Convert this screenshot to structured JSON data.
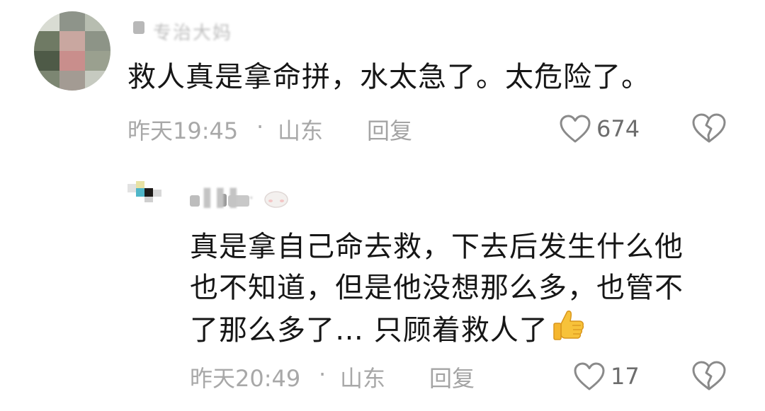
{
  "comments": [
    {
      "text": "救人真是拿命拼，水太急了。太危险了。",
      "time": "昨天19:45",
      "separator": "·",
      "location": "山东",
      "reply_label": "回复",
      "likes": "674",
      "username_obscured": "专治大妈",
      "icons": {
        "like": "heart-outline-icon",
        "dislike": "broken-heart-icon"
      }
    },
    {
      "text_lines": [
        "真是拿自己命去救，下去后发生什么他",
        "也不知道，但是他没想那么多，也管不",
        "了那么多了… 只顾着救人了"
      ],
      "time": "昨天20:49",
      "separator": "·",
      "location": "山东",
      "reply_label": "回复",
      "likes": "17",
      "username_obscured": "▌▌▌ ·",
      "icons": {
        "like": "heart-outline-icon",
        "dislike": "broken-heart-icon",
        "emoji": "thumbs-up-emoji"
      }
    }
  ],
  "colors": {
    "text": "#161616",
    "meta": "#a8a8a8",
    "count": "#6d6d6d",
    "icon": "#8a8a8a",
    "background": "#ffffff"
  }
}
